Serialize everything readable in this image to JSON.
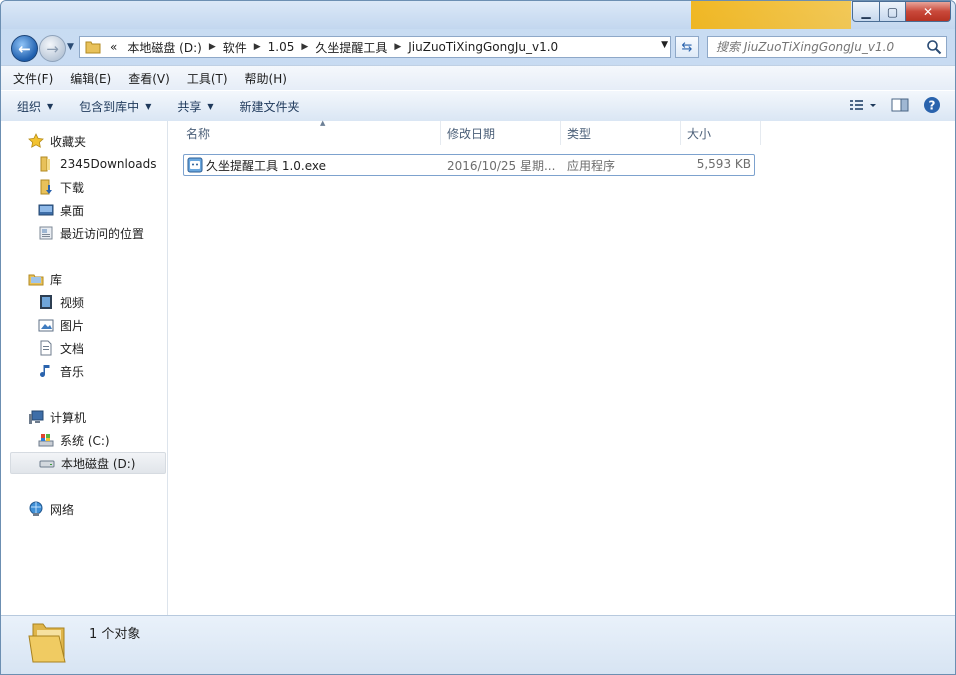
{
  "window": {
    "caption_minimize": "▁",
    "caption_maximize": "▢",
    "caption_close": "✕"
  },
  "address_bar": {
    "prefix": "«",
    "breadcrumbs": [
      "本地磁盘 (D:)",
      "软件",
      "1.05",
      "久坐提醒工具",
      "JiuZuoTiXingGongJu_v1.0"
    ]
  },
  "search": {
    "placeholder": "搜索 JiuZuoTiXingGongJu_v1.0"
  },
  "menubar": {
    "items": [
      "文件(F)",
      "编辑(E)",
      "查看(V)",
      "工具(T)",
      "帮助(H)"
    ]
  },
  "toolbar": {
    "organize": "组织",
    "include_library": "包含到库中",
    "share": "共享",
    "new_folder": "新建文件夹"
  },
  "nav": {
    "favorites": "收藏夹",
    "fav_items": [
      "2345Downloads",
      "下载",
      "桌面",
      "最近访问的位置"
    ],
    "libraries": "库",
    "lib_items": [
      "视频",
      "图片",
      "文档",
      "音乐"
    ],
    "computer": "计算机",
    "comp_items": [
      "系统 (C:)",
      "本地磁盘 (D:)"
    ],
    "network": "网络"
  },
  "columns": {
    "name": "名称",
    "modified": "修改日期",
    "type": "类型",
    "size": "大小"
  },
  "files": [
    {
      "name": "久坐提醒工具 1.0.exe",
      "modified": "2016/10/25 星期...",
      "type": "应用程序",
      "size": "5,593 KB"
    }
  ],
  "status": {
    "count": "1 个对象"
  },
  "colors": {
    "accent": "#2a63ad",
    "selection_border": "#7da2ce"
  }
}
